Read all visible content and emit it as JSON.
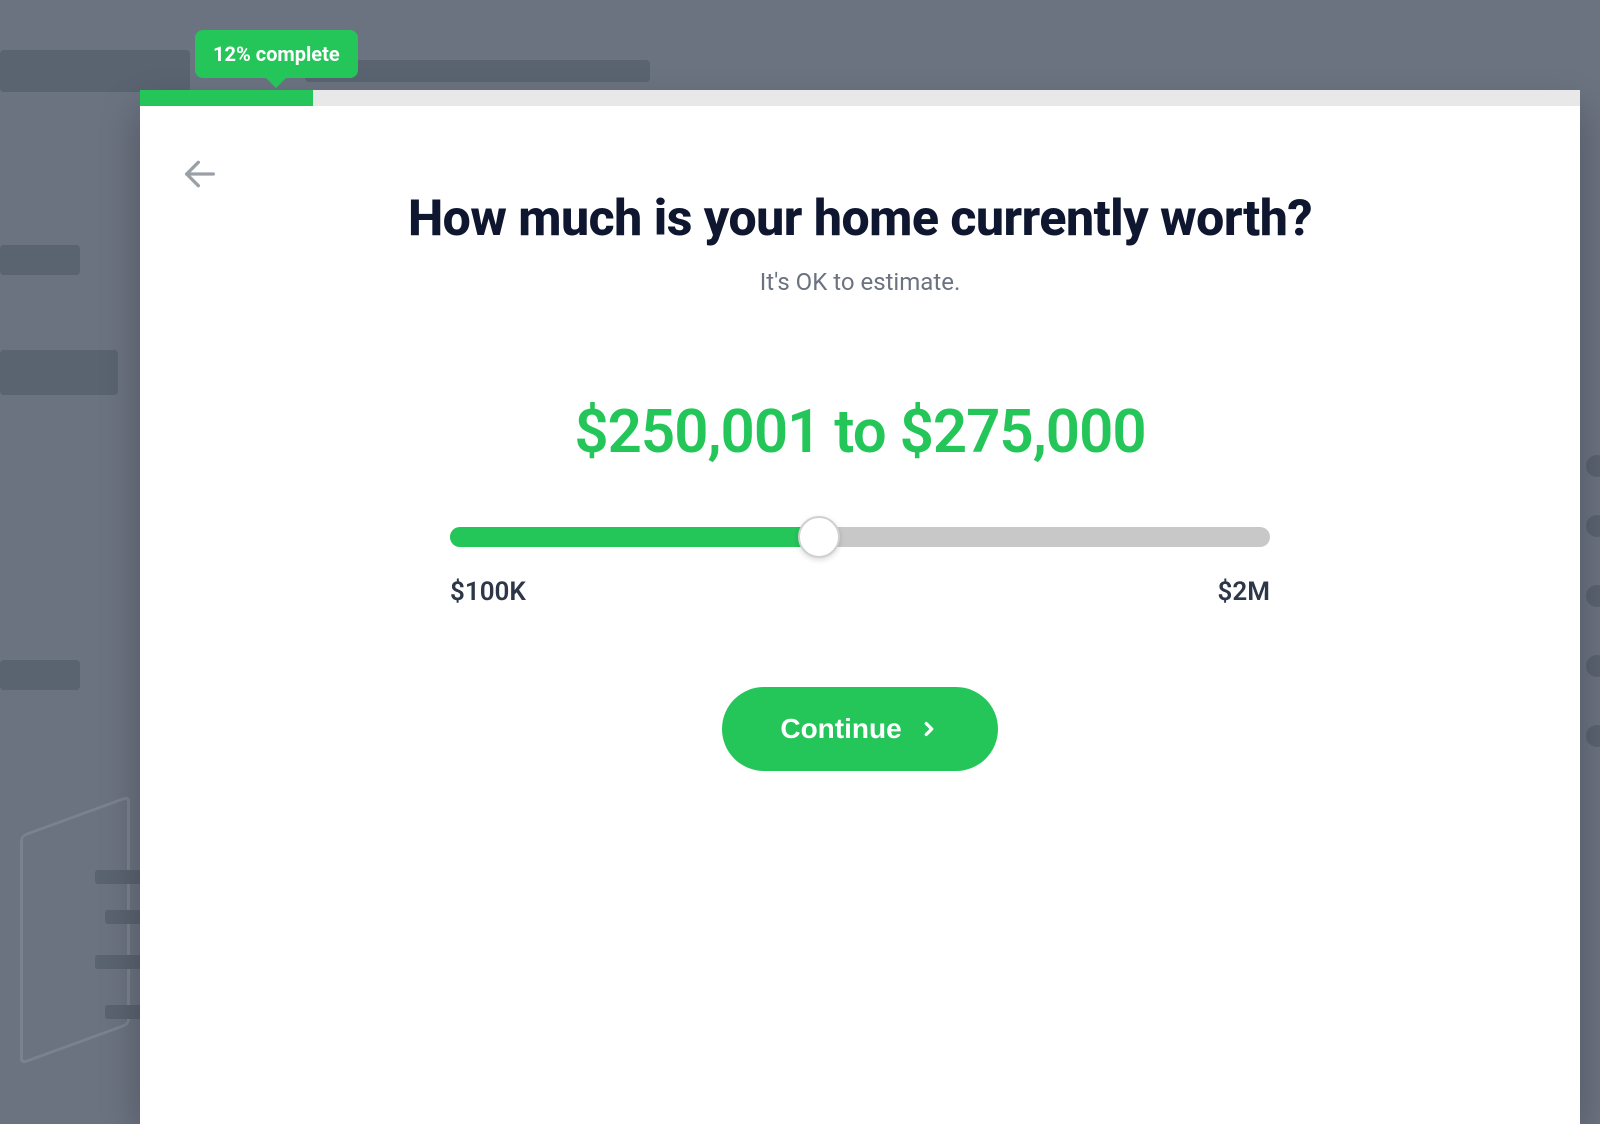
{
  "progress": {
    "percent": 12,
    "label": "12% complete"
  },
  "question": {
    "title": "How much is your home currently worth?",
    "subtitle": "It's OK to estimate."
  },
  "slider": {
    "value_display": "$250,001 to $275,000",
    "min_label": "$100K",
    "max_label": "$2M",
    "fill_percent": 45
  },
  "actions": {
    "continue_label": "Continue"
  },
  "colors": {
    "accent": "#24c65a",
    "text_primary": "#0f1730",
    "text_secondary": "#6b7280"
  }
}
